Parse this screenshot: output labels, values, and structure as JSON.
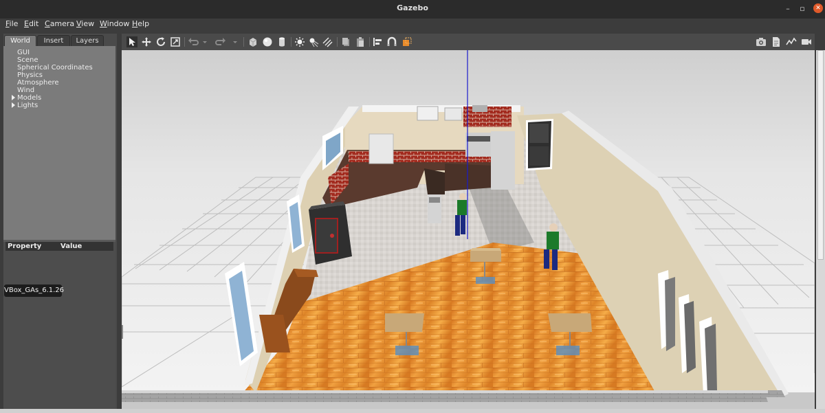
{
  "window": {
    "title": "Gazebo",
    "controls": [
      "minimize-icon",
      "restore-icon",
      "close-icon"
    ]
  },
  "menubar": {
    "items": [
      {
        "label": "File",
        "accel": "F"
      },
      {
        "label": "Edit",
        "accel": "E"
      },
      {
        "label": "Camera",
        "accel": "C"
      },
      {
        "label": "View",
        "accel": "V"
      },
      {
        "label": "Window",
        "accel": "W"
      },
      {
        "label": "Help",
        "accel": "H"
      }
    ]
  },
  "left_panel": {
    "tabs": [
      {
        "label": "World",
        "active": true
      },
      {
        "label": "Insert",
        "active": false
      },
      {
        "label": "Layers",
        "active": false
      }
    ],
    "tree": [
      {
        "label": "GUI",
        "expandable": false
      },
      {
        "label": "Scene",
        "expandable": false
      },
      {
        "label": "Spherical Coordinates",
        "expandable": false
      },
      {
        "label": "Physics",
        "expandable": false
      },
      {
        "label": "Atmosphere",
        "expandable": false
      },
      {
        "label": "Wind",
        "expandable": false
      },
      {
        "label": "Models",
        "expandable": true
      },
      {
        "label": "Lights",
        "expandable": true
      }
    ],
    "properties": {
      "col_property": "Property",
      "col_value": "Value"
    }
  },
  "tooltip": {
    "text": "VBox_GAs_6.1.26"
  },
  "toolbar": {
    "left_icons": [
      "select-arrow-icon",
      "translate-icon",
      "rotate-icon",
      "scale-icon",
      "undo-icon",
      "undo-history-icon",
      "redo-icon",
      "redo-history-icon",
      "box-shape-icon",
      "sphere-shape-icon",
      "cylinder-shape-icon",
      "point-light-icon",
      "spot-light-icon",
      "directional-light-icon",
      "copy-icon",
      "paste-icon",
      "align-icon",
      "snap-icon",
      "change-view-icon"
    ],
    "right_icons": [
      "screenshot-icon",
      "log-icon",
      "plot-icon",
      "record-video-icon"
    ]
  },
  "colors": {
    "titlebar_bg": "#2b2b2b",
    "panel_bg": "#7b7b7b",
    "floor_wood": "#e08a2a",
    "floor_tile": "#d9d6d2",
    "wall": "#d9ccb0",
    "grid_bg": "#f2f2f2",
    "close_accent": "#e05a2a",
    "axis_z": "#1a1acc"
  }
}
